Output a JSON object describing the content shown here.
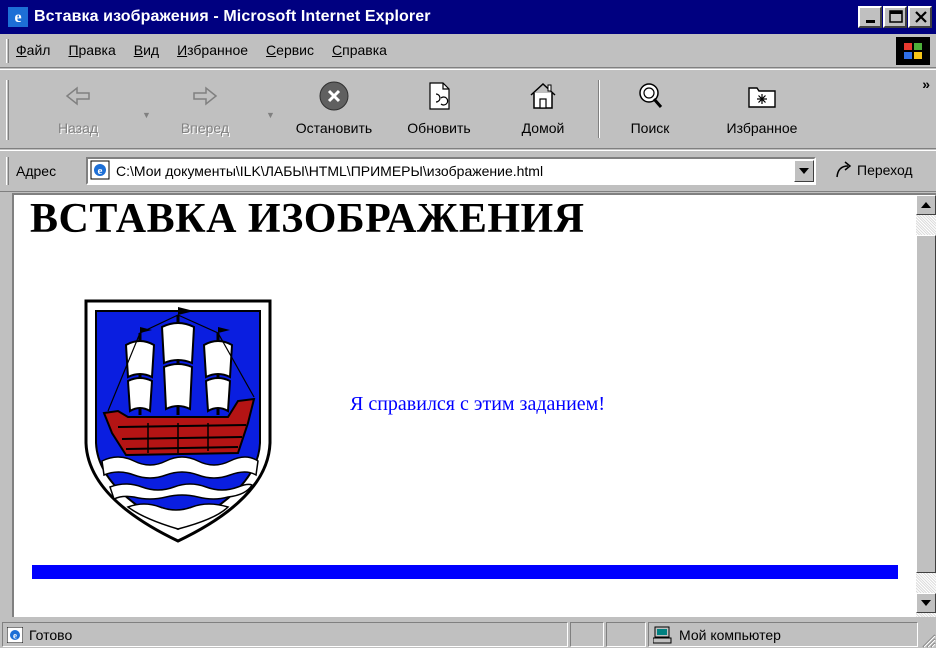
{
  "window": {
    "title": "Вставка изображения - Microsoft Internet Explorer"
  },
  "menu": {
    "items": [
      {
        "label": "Файл",
        "underline": "Ф",
        "rest": "айл"
      },
      {
        "label": "Правка",
        "underline": "П",
        "rest": "равка"
      },
      {
        "label": "Вид",
        "underline": "В",
        "rest": "ид"
      },
      {
        "label": "Избранное",
        "underline": "И",
        "rest": "збранное"
      },
      {
        "label": "Сервис",
        "underline": "С",
        "rest": "ервис"
      },
      {
        "label": "Справка",
        "underline": "С",
        "rest": "правка"
      }
    ]
  },
  "toolbar": {
    "back_label": "Назад",
    "forward_label": "Вперед",
    "stop_label": "Остановить",
    "refresh_label": "Обновить",
    "home_label": "Домой",
    "search_label": "Поиск",
    "favorites_label": "Избранное",
    "more_label": "»"
  },
  "address": {
    "label": "Адрес",
    "url": "C:\\Мои документы\\ILK\\ЛАБЫ\\HTML\\ПРИМЕРЫ\\изображение.html",
    "go_label": "Переход"
  },
  "document": {
    "heading": "ВСТАВКА ИЗОБРАЖЕНИЯ",
    "text": "Я справился с этим заданием!",
    "image_icon": "coat-of-arms-ship",
    "rule_color": "#0000ff",
    "text_color": "#0000ff"
  },
  "status": {
    "text": "Готово",
    "zone": "Мой компьютер"
  },
  "colors": {
    "titlebar": "#000080",
    "chrome": "#c0c0c0",
    "shield_blue": "#0a1ee0",
    "ship_red": "#b41414"
  }
}
